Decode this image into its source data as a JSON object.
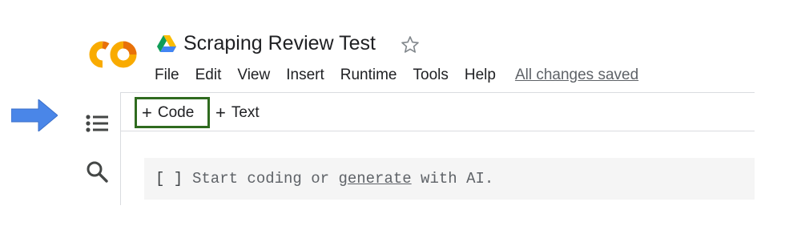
{
  "header": {
    "title": "Scraping Review Test",
    "logo_icon": "colab-logo",
    "drive_icon": "google-drive-icon",
    "star_icon": "star-outline-icon"
  },
  "menu": {
    "items": [
      "File",
      "Edit",
      "View",
      "Insert",
      "Runtime",
      "Tools",
      "Help"
    ],
    "save_status": "All changes saved"
  },
  "sidebar": {
    "icons": [
      "table-of-contents-icon",
      "search-icon"
    ]
  },
  "toolbar": {
    "code_label": "Code",
    "text_label": "Text",
    "plus_glyph": "+",
    "highlight_color": "#2f6b1f"
  },
  "cell": {
    "run_bracket": "[ ]",
    "placeholder_before": "Start coding or ",
    "placeholder_link": "generate",
    "placeholder_after": " with AI."
  },
  "annotation": {
    "arrow_color": "#4a86e8"
  }
}
